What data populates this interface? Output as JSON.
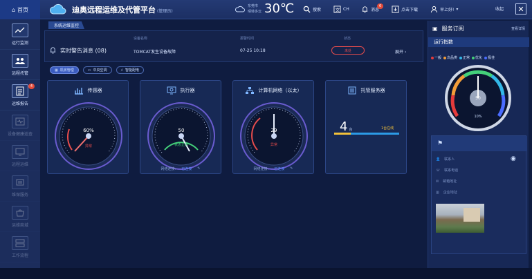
{
  "topbar": {
    "home_label": "首页",
    "app_title": "迪奥远程运维及代管平台",
    "app_role": "(管理员)",
    "weather_city": "东莞市",
    "weather_desc": "晴转多云",
    "temperature": "30℃",
    "search_label": "搜索",
    "ch_label": "CH",
    "messages_label": "消息",
    "messages_count": "6",
    "download_label": "点击下载",
    "user_label": "早上好!",
    "collapse_label": "收起"
  },
  "sidebar": {
    "items": [
      {
        "label": "运行监测",
        "icon": "chart-monitor-icon",
        "active": true
      },
      {
        "label": "远程托管",
        "icon": "people-icon",
        "active": true
      },
      {
        "label": "运维报告",
        "icon": "report-icon",
        "active": true,
        "badge": "4"
      },
      {
        "label": "设备健康巡查",
        "icon": "health-check-icon",
        "active": false
      },
      {
        "label": "远程运维",
        "icon": "remote-icon",
        "active": false
      },
      {
        "label": "维保服务",
        "icon": "service-icon",
        "active": false
      },
      {
        "label": "运维商城",
        "icon": "shop-icon",
        "active": false
      },
      {
        "label": "工作流程",
        "icon": "workflow-icon",
        "active": false
      }
    ]
  },
  "main": {
    "tab_label": "系统运维监控",
    "alert": {
      "title": "实时警告消息 (08)",
      "device_header": "设备名称",
      "device_value": "TOMCAT发生设备故障",
      "time_header": "报警时间",
      "time_value": "07-25 10:18",
      "status_header": "状态",
      "status_value": "未处",
      "expand_label": "展开"
    },
    "categories": [
      {
        "label": "机房管理",
        "active": true
      },
      {
        "label": "中央空调",
        "active": false
      },
      {
        "label": "智能配电",
        "active": false
      }
    ],
    "cards": [
      {
        "title": "传感器",
        "gauge_value": "60%",
        "gauge_status": "异常",
        "footer_left": "",
        "footer_link": ""
      },
      {
        "title": "执行器",
        "gauge_value": "50",
        "gauge_status": "状态正常",
        "footer_left": "网络连接:",
        "footer_link": "已连接"
      },
      {
        "title": "计算机网络（以太）",
        "gauge_value": "29",
        "gauge_status": "异常",
        "footer_left": "网络连接:",
        "footer_link": "已连接"
      },
      {
        "title": "托管服务器",
        "host_count": "4",
        "host_unit": "台",
        "host_online": "1台在线"
      }
    ]
  },
  "right_panel": {
    "title": "服务订阅",
    "more_label": "查看详情",
    "index_title": "运行指数",
    "legend": [
      {
        "label": "一般",
        "color": "#e53b3b"
      },
      {
        "label": "次品类",
        "color": "#f29d38"
      },
      {
        "label": "正常",
        "color": "#33b8e8"
      },
      {
        "label": "优化",
        "color": "#44d17a"
      },
      {
        "label": "极佳",
        "color": "#4a6cff"
      }
    ],
    "gauge_value": "50",
    "gauge_label": "10%",
    "contacts": [
      {
        "label": "联系人"
      },
      {
        "label": "联系电话"
      },
      {
        "label": "邮箱地址"
      },
      {
        "label": "企业地址"
      }
    ]
  }
}
